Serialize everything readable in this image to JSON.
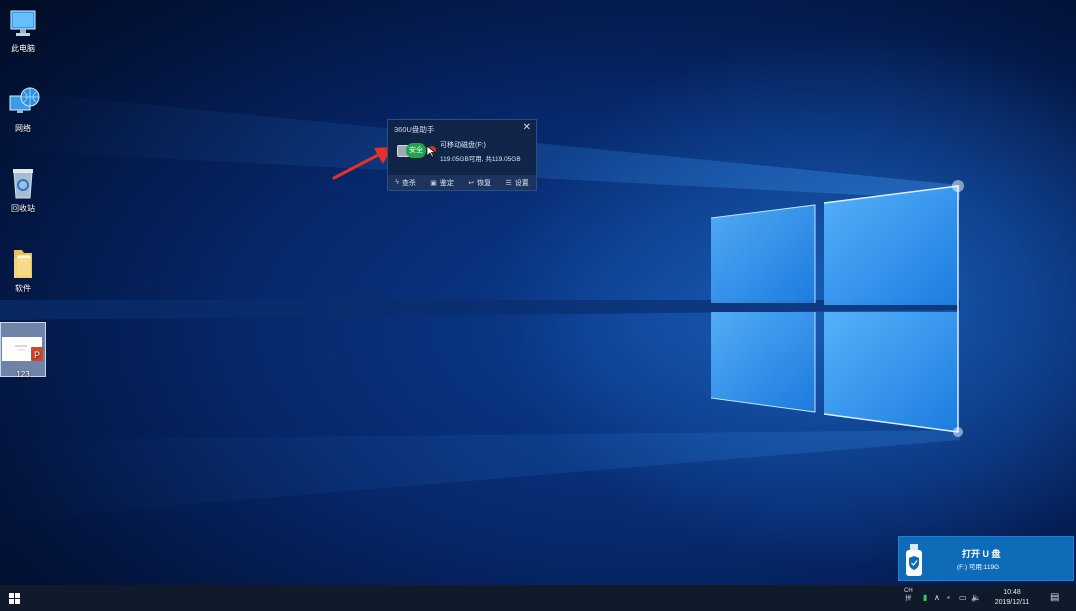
{
  "desktop_icons": [
    {
      "label": "此电脑",
      "icon": "computer-icon"
    },
    {
      "label": "网络",
      "icon": "network-icon"
    },
    {
      "label": "回收站",
      "icon": "recycle-bin-icon"
    },
    {
      "label": "软件",
      "icon": "folder-icon"
    },
    {
      "label": "123",
      "icon": "powerpoint-file-icon"
    }
  ],
  "widget": {
    "title": "360U盘助手",
    "close": "✕",
    "safe_badge": "安全",
    "drive_name": "可移动磁盘(F:)",
    "drive_space": "119.05GB可用, 共119.05GB",
    "tools": [
      {
        "label": "查杀",
        "icon": "bolt-icon"
      },
      {
        "label": "鉴定",
        "icon": "lock-icon"
      },
      {
        "label": "恢复",
        "icon": "restore-icon"
      },
      {
        "label": "设置",
        "icon": "list-icon"
      }
    ]
  },
  "toast": {
    "title": "打开 U 盘",
    "subtitle": "(F:)  可用:119G"
  },
  "taskbar": {
    "ime_top": "CH",
    "ime_bottom": "拼",
    "time": "10:48",
    "date": "2019/12/11"
  },
  "colors": {
    "accent": "#0d6bb8",
    "safe_green": "#21a54b",
    "arrow_red": "#e8302a"
  }
}
